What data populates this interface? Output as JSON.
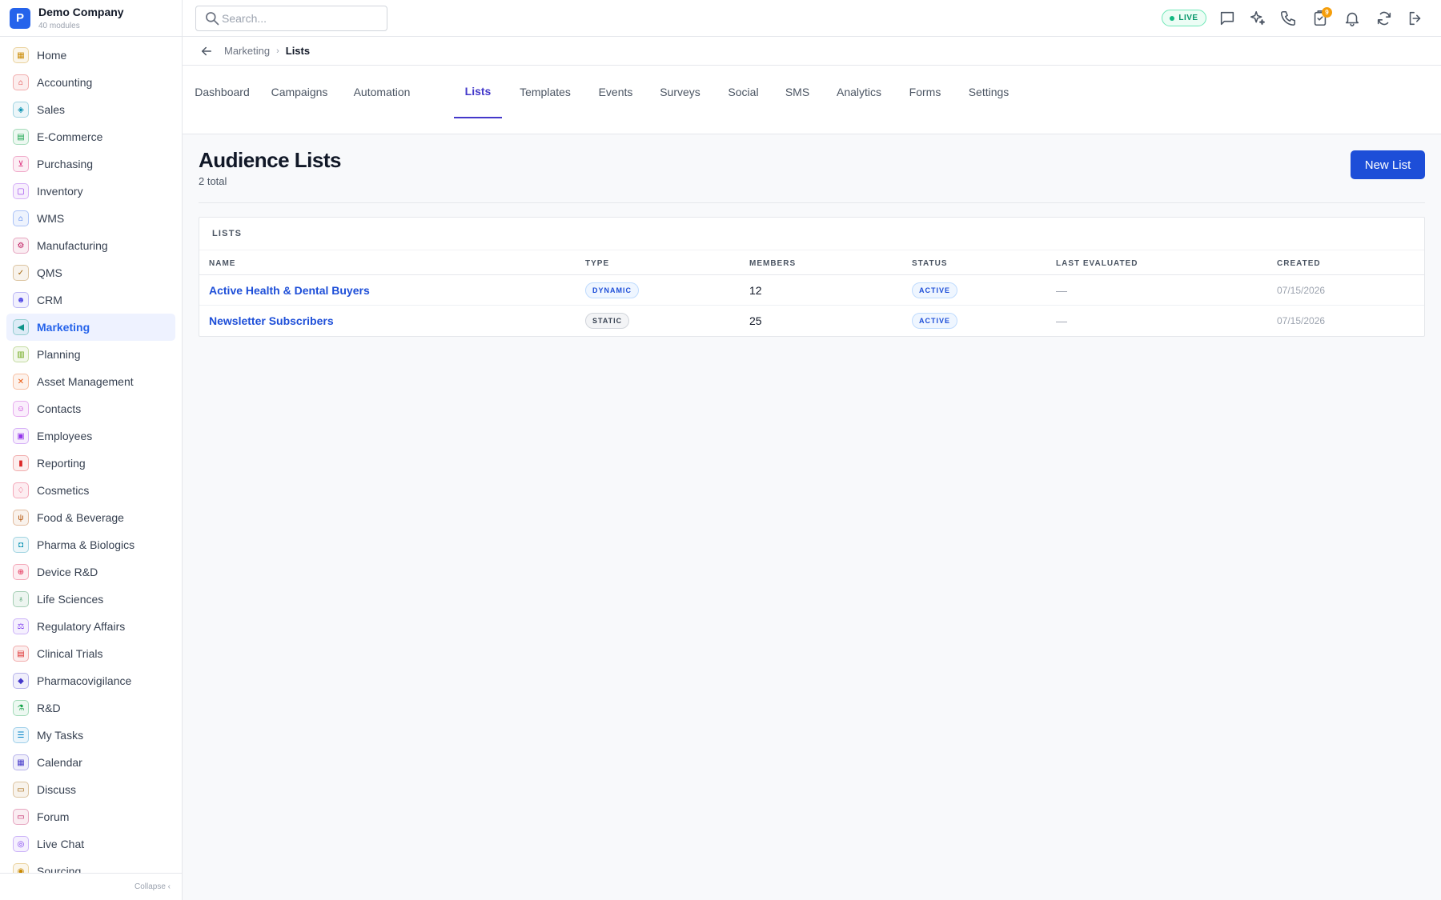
{
  "company": {
    "name": "Demo Company",
    "subtitle": "40 modules",
    "logo_letter": "P"
  },
  "sidebar": {
    "items": [
      {
        "label": "Home",
        "icon": "grid-icon",
        "color": "#ca8a04",
        "glyph": "▦"
      },
      {
        "label": "Accounting",
        "icon": "bank-icon",
        "color": "#dc2626",
        "glyph": "⌂"
      },
      {
        "label": "Sales",
        "icon": "tag-icon",
        "color": "#0891b2",
        "glyph": "◈"
      },
      {
        "label": "E-Commerce",
        "icon": "store-icon",
        "color": "#16a34a",
        "glyph": "▤"
      },
      {
        "label": "Purchasing",
        "icon": "cart-icon",
        "color": "#db2777",
        "glyph": "⊻"
      },
      {
        "label": "Inventory",
        "icon": "box-icon",
        "color": "#9333ea",
        "glyph": "▢"
      },
      {
        "label": "WMS",
        "icon": "warehouse-icon",
        "color": "#2563eb",
        "glyph": "⌂"
      },
      {
        "label": "Manufacturing",
        "icon": "factory-icon",
        "color": "#be185d",
        "glyph": "⚙"
      },
      {
        "label": "QMS",
        "icon": "badge-check-icon",
        "color": "#a16207",
        "glyph": "✓"
      },
      {
        "label": "CRM",
        "icon": "users-icon",
        "color": "#4f46e5",
        "glyph": "☻"
      },
      {
        "label": "Marketing",
        "icon": "megaphone-icon",
        "color": "#0d9488",
        "glyph": "◀"
      },
      {
        "label": "Planning",
        "icon": "calendar-grid-icon",
        "color": "#65a30d",
        "glyph": "▥"
      },
      {
        "label": "Asset Management",
        "icon": "tools-icon",
        "color": "#ea580c",
        "glyph": "✕"
      },
      {
        "label": "Contacts",
        "icon": "contact-card-icon",
        "color": "#c026d3",
        "glyph": "☺"
      },
      {
        "label": "Employees",
        "icon": "briefcase-icon",
        "color": "#9333ea",
        "glyph": "▣"
      },
      {
        "label": "Reporting",
        "icon": "bar-chart-icon",
        "color": "#dc2626",
        "glyph": "▮"
      },
      {
        "label": "Cosmetics",
        "icon": "flask-icon",
        "color": "#e11d48",
        "glyph": "♢"
      },
      {
        "label": "Food & Beverage",
        "icon": "utensils-icon",
        "color": "#b45309",
        "glyph": "ψ"
      },
      {
        "label": "Pharma & Biologics",
        "icon": "pill-icon",
        "color": "#0891b2",
        "glyph": "◘"
      },
      {
        "label": "Device R&D",
        "icon": "chip-icon",
        "color": "#e11d48",
        "glyph": "⊕"
      },
      {
        "label": "Life Sciences",
        "icon": "microscope-icon",
        "color": "#15803d",
        "glyph": "♁"
      },
      {
        "label": "Regulatory Affairs",
        "icon": "gavel-icon",
        "color": "#7c3aed",
        "glyph": "⚖"
      },
      {
        "label": "Clinical Trials",
        "icon": "clipboard-icon",
        "color": "#dc2626",
        "glyph": "▤"
      },
      {
        "label": "Pharmacovigilance",
        "icon": "shield-icon",
        "color": "#4338ca",
        "glyph": "◆"
      },
      {
        "label": "R&D",
        "icon": "beaker-icon",
        "color": "#16a34a",
        "glyph": "⚗"
      },
      {
        "label": "My Tasks",
        "icon": "checklist-icon",
        "color": "#0284c7",
        "glyph": "☰"
      },
      {
        "label": "Calendar",
        "icon": "calendar-icon",
        "color": "#4338ca",
        "glyph": "▦"
      },
      {
        "label": "Discuss",
        "icon": "chat-bubbles-icon",
        "color": "#a16207",
        "glyph": "▭"
      },
      {
        "label": "Forum",
        "icon": "forum-icon",
        "color": "#be185d",
        "glyph": "▭"
      },
      {
        "label": "Live Chat",
        "icon": "headset-icon",
        "color": "#7c3aed",
        "glyph": "◎"
      },
      {
        "label": "Sourcing",
        "icon": "sourcing-icon",
        "color": "#ca8a04",
        "glyph": "◉"
      }
    ],
    "active_index": 10,
    "collapse_label": "Collapse ‹"
  },
  "topbar": {
    "search_placeholder": "Search...",
    "live_label": "LIVE",
    "tasks_badge": "9",
    "icons": [
      "message-icon",
      "sparkles-icon",
      "phone-icon",
      "tasks-icon",
      "bell-icon",
      "refresh-icon",
      "logout-icon"
    ]
  },
  "breadcrumb": {
    "parent": "Marketing",
    "separator": "›",
    "current": "Lists"
  },
  "tabs": [
    {
      "label": "Dashboard"
    },
    {
      "label": "Campaigns"
    },
    {
      "label": "Automation"
    },
    {
      "label": "Lists",
      "active": true
    },
    {
      "label": "Templates"
    },
    {
      "label": "Events"
    },
    {
      "label": "Surveys"
    },
    {
      "label": "Social"
    },
    {
      "label": "SMS"
    },
    {
      "label": "Analytics"
    },
    {
      "label": "Forms"
    },
    {
      "label": "Settings"
    }
  ],
  "page": {
    "title": "Audience Lists",
    "count": "2 total",
    "new_button": "New List"
  },
  "lists_card": {
    "title": "LISTS",
    "columns": [
      "NAME",
      "TYPE",
      "MEMBERS",
      "STATUS",
      "LAST EVALUATED",
      "CREATED"
    ],
    "rows": [
      {
        "name": "Active Health & Dental Buyers",
        "type": "DYNAMIC",
        "members": "12",
        "status": "ACTIVE",
        "last_evaluated": "—",
        "created": "07/15/2026"
      },
      {
        "name": "Newsletter Subscribers",
        "type": "STATIC",
        "members": "25",
        "status": "ACTIVE",
        "last_evaluated": "—",
        "created": "07/15/2026"
      }
    ]
  },
  "colors": {
    "accent": "#1d4ed8",
    "active_tab": "#4338ca",
    "live": "#059669",
    "badge": "#f59e0b"
  }
}
